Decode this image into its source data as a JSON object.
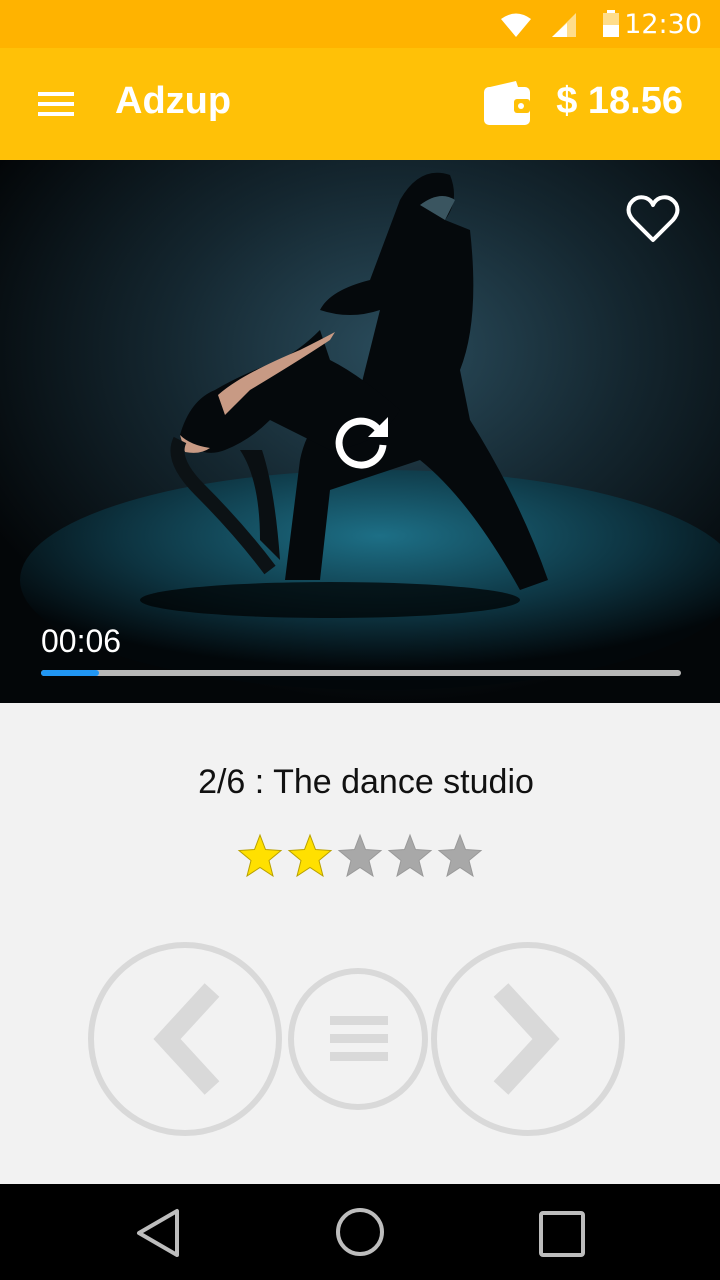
{
  "status_bar": {
    "time": "12:30",
    "icons": [
      "wifi-icon",
      "cell-signal-icon",
      "battery-icon"
    ]
  },
  "app_bar": {
    "title": "Adzup",
    "balance": "$ 18.56",
    "icons": [
      "menu-icon",
      "wallet-icon"
    ]
  },
  "video": {
    "elapsed": "00:06",
    "progress": 0.09,
    "icons": [
      "heart-icon",
      "replay-icon"
    ]
  },
  "content": {
    "title": "2/6 : The dance studio",
    "rating": {
      "value": 2,
      "max": 5
    }
  },
  "controls": {
    "icons": [
      "chevron-left-icon",
      "list-icon",
      "chevron-right-icon"
    ]
  },
  "system_nav": {
    "icons": [
      "back-triangle-icon",
      "home-circle-icon",
      "recents-square-icon"
    ]
  },
  "colors": {
    "status_bar": "#ffb300",
    "app_bar": "#ffc107",
    "progress": "#2196f3",
    "star_on": "#ffe000",
    "star_off": "#a8a8a8",
    "control_gray": "#d9d9d9"
  }
}
